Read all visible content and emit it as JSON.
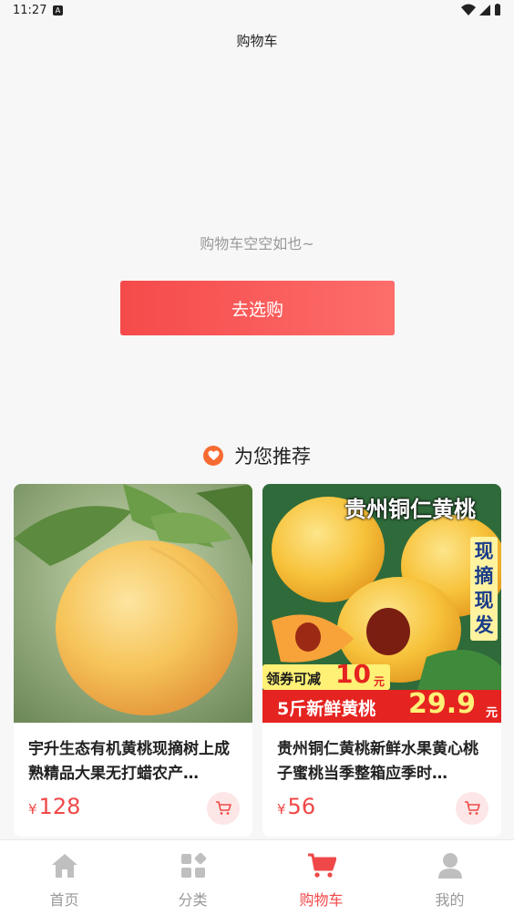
{
  "status_bar": {
    "time": "11:27",
    "a_badge": "A"
  },
  "header": {
    "title": "购物车"
  },
  "empty": {
    "message": "购物车空空如也~",
    "button_label": "去选购"
  },
  "recommend": {
    "title": "为您推荐",
    "icon": "heart-icon"
  },
  "products": [
    {
      "name": "宇升生态有机黄桃现摘树上成熟精品大果无打蜡农产…",
      "price_symbol": "¥",
      "price": "128",
      "image": "peach-on-tree"
    },
    {
      "name": "贵州铜仁黄桃新鲜水果黄心桃子蜜桃当季整箱应季时…",
      "price_symbol": "¥",
      "price": "56",
      "image": "peach-promo",
      "image_texts": {
        "title": "贵州铜仁黄桃",
        "side": "现摘现发",
        "coupon": "领券可减",
        "coupon_amount": "10",
        "coupon_unit": "元",
        "promo": "5斤新鲜黄桃",
        "promo_price": "29.9",
        "promo_price_unit": "元"
      }
    }
  ],
  "tabs": [
    {
      "label": "首页",
      "icon": "home-icon",
      "active": false
    },
    {
      "label": "分类",
      "icon": "category-icon",
      "active": false
    },
    {
      "label": "购物车",
      "icon": "cart-icon",
      "active": true
    },
    {
      "label": "我的",
      "icon": "profile-icon",
      "active": false
    }
  ],
  "colors": {
    "accent": "#f04848",
    "button_start": "#f54a4a",
    "button_end": "#fd6e6b",
    "heart": "#f66b32"
  }
}
